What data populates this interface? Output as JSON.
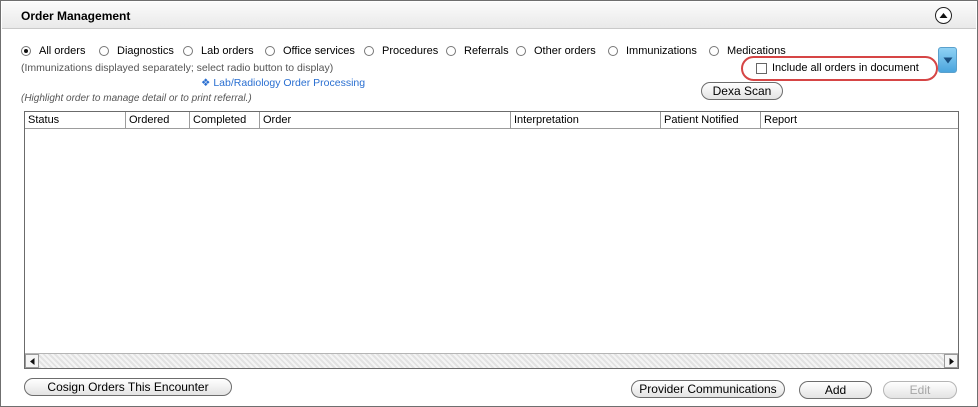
{
  "header": {
    "title": "Order Management",
    "collapse_icon": "collapse-up-icon"
  },
  "filters": {
    "options": [
      {
        "label": "All orders",
        "selected": true
      },
      {
        "label": "Diagnostics",
        "selected": false
      },
      {
        "label": "Lab orders",
        "selected": false
      },
      {
        "label": "Office services",
        "selected": false
      },
      {
        "label": "Procedures",
        "selected": false
      },
      {
        "label": "Referrals",
        "selected": false
      },
      {
        "label": "Other orders",
        "selected": false
      },
      {
        "label": "Immunizations",
        "selected": false
      },
      {
        "label": "Medications",
        "selected": false
      }
    ],
    "note": "(Immunizations displayed separately; select radio button to display)"
  },
  "links": {
    "lab_radiology": "❖ Lab/Radiology Order Processing"
  },
  "highlight_note": "(Highlight order to manage detail or to print referral.)",
  "include_all": {
    "label": "Include all orders in document",
    "checked": false,
    "highlight_color": "#d64545"
  },
  "buttons": {
    "dexa_scan": "Dexa Scan",
    "cosign": "Cosign Orders This Encounter",
    "provider_comm": "Provider Communications",
    "add": "Add",
    "edit": "Edit"
  },
  "table": {
    "columns": [
      "Status",
      "Ordered",
      "Completed",
      "Order",
      "Interpretation",
      "Patient Notified",
      "Report"
    ],
    "rows": []
  },
  "colors": {
    "link": "#2a6fd1",
    "accent_tab": "#4aa4dd"
  }
}
